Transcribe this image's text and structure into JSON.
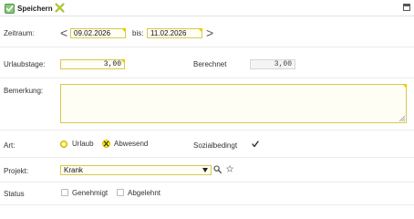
{
  "toolbar": {
    "save_label": "Speichern"
  },
  "zeitraum": {
    "label": "Zeitraum:",
    "from": "09.02.2026",
    "bis_label": "bis:",
    "to": "11.02.2026",
    "prev_arrow": "<",
    "next_arrow": ">"
  },
  "urlaubstage": {
    "label": "Urlaubstage:",
    "value": "3,00",
    "berechnet_label": "Berechnet",
    "berechnet_value": "3,00"
  },
  "bemerkung": {
    "label": "Bemerkung:",
    "value": ""
  },
  "art": {
    "label": "Art:",
    "option_urlaub": "Urlaub",
    "option_abwesend": "Abwesend",
    "selected": "Abwesend",
    "sozialbedingt_label": "Sozialbedingt",
    "sozialbedingt_checked": true
  },
  "projekt": {
    "label": "Projekt:",
    "selected": "Krank"
  },
  "status": {
    "label": "Status",
    "genehmigt_label": "Genehmigt",
    "abgelehnt_label": "Abgelehnt"
  },
  "colors": {
    "accent_yellow": "#ffe600",
    "input_border": "#d8c850",
    "save_icon_green": "#58b04a"
  },
  "icons": {
    "save": "save-check-icon",
    "cancel": "cancel-x-icon",
    "maximize": "maximize-icon",
    "search": "search-icon",
    "star": "star-icon"
  }
}
